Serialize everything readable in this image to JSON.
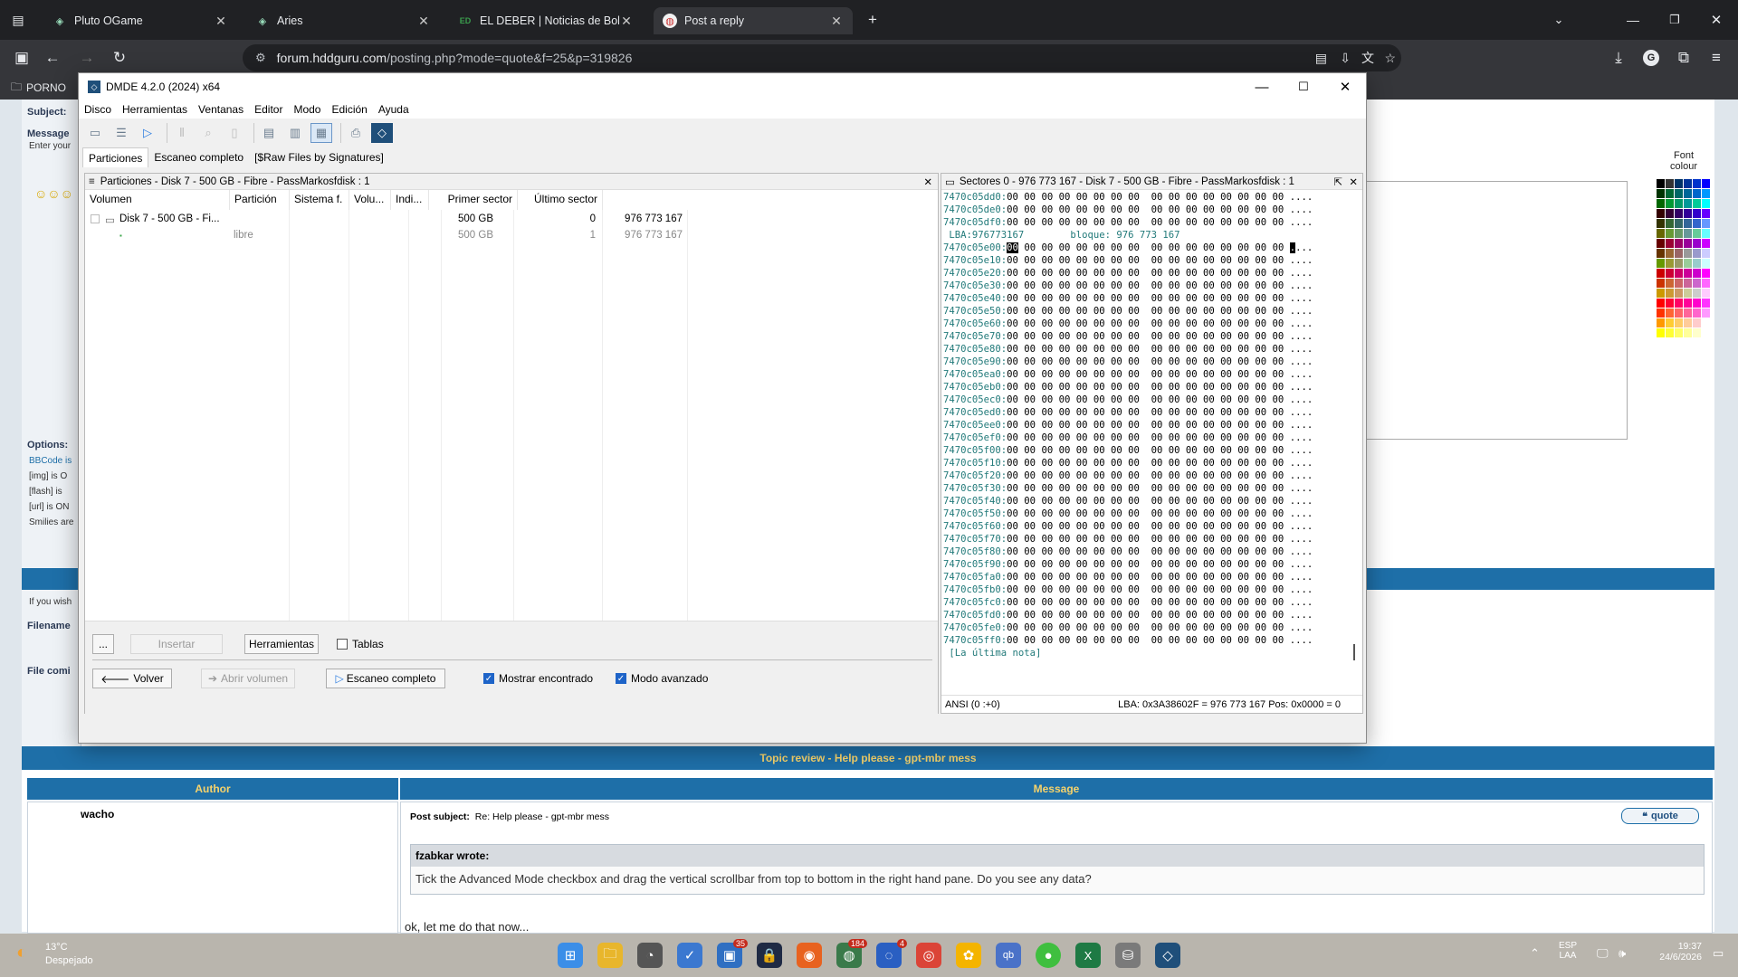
{
  "browser": {
    "tabs": [
      {
        "label": "Pluto OGame",
        "icon": "pluto-icon"
      },
      {
        "label": "Aries",
        "icon": "aries-icon"
      },
      {
        "label": "EL DEBER | Noticias de Bolivia y",
        "icon": "eldeber-icon"
      },
      {
        "label": "Post a reply",
        "icon": "hddguru-icon",
        "active": true
      }
    ],
    "url_domain": "forum.hddguru.com",
    "url_path": "/posting.php?mode=quote&f=25&p=319826",
    "bookmark": "PORNO",
    "profile_initial": "G"
  },
  "forum": {
    "subject_label": "Subject:",
    "message_label": "Message",
    "message_hint": "Enter your",
    "options_label": "Options:",
    "options": [
      "BBCode is",
      "[img] is O",
      "[flash] is",
      "[url] is ON",
      "Smilies are"
    ],
    "if_you_wish": "If you wish",
    "filename_label": "Filename",
    "file_comment_label": "File comi",
    "font_colour": "Font colour",
    "topic_review": "Topic review - Help please - gpt-mbr mess",
    "author_header": "Author",
    "message_header": "Message",
    "author": "wacho",
    "post_subject_label": "Post subject:",
    "post_subject": "Re: Help please - gpt-mbr mess",
    "quote_button": "quote",
    "quote_author": "fzabkar wrote:",
    "quote_text": "Tick the Advanced Mode checkbox and drag the vertical scrollbar from top to bottom in the right hand pane. Do you see any data?",
    "reply_text": "ok, let me do that now..."
  },
  "dmde": {
    "title": "DMDE 4.2.0 (2024) x64",
    "menu": [
      "Disco",
      "Herramientas",
      "Ventanas",
      "Editor",
      "Modo",
      "Edición",
      "Ayuda"
    ],
    "tabs": [
      "Particiones",
      "Escaneo completo",
      "[$Raw Files by Signatures]"
    ],
    "left_pane": {
      "title": "Particiones - Disk 7 - 500 GB - Fibre - PassMarkosfdisk : 1",
      "columns": [
        "Volumen",
        "Partición",
        "Sistema f.",
        "Volu...",
        "Indi...",
        "Primer sector",
        "Último sector"
      ],
      "rows": [
        {
          "volume": "Disk 7 - 500 GB - Fi...",
          "partition": "",
          "size": "500 GB",
          "first": "0",
          "last": "976 773 167"
        },
        {
          "volume": "",
          "partition": "libre",
          "size": "500 GB",
          "first": "1",
          "last": "976 773 167"
        }
      ],
      "buttons": {
        "more": "...",
        "insert": "Insertar",
        "tools": "Herramientas",
        "tables": "Tablas",
        "back": "Volver",
        "open_volume": "Abrir volumen",
        "full_scan": "Escaneo completo"
      },
      "checks": {
        "show_found": "Mostrar encontrado",
        "advanced_mode": "Modo avanzado"
      }
    },
    "right_pane": {
      "title": "Sectores 0 - 976 773 167 - Disk 7 - 500 GB - Fibre - PassMarkosfdisk : 1",
      "top_rows": [
        "7470c05dd0",
        "7470c05de0",
        "7470c05df0"
      ],
      "lba_line": " LBA:976773167        bloque: 976 773 167",
      "rows": [
        "7470c05e00",
        "7470c05e10",
        "7470c05e20",
        "7470c05e30",
        "7470c05e40",
        "7470c05e50",
        "7470c05e60",
        "7470c05e70",
        "7470c05e80",
        "7470c05e90",
        "7470c05ea0",
        "7470c05eb0",
        "7470c05ec0",
        "7470c05ed0",
        "7470c05ee0",
        "7470c05ef0",
        "7470c05f00",
        "7470c05f10",
        "7470c05f20",
        "7470c05f30",
        "7470c05f40",
        "7470c05f50",
        "7470c05f60",
        "7470c05f70",
        "7470c05f80",
        "7470c05f90",
        "7470c05fa0",
        "7470c05fb0",
        "7470c05fc0",
        "7470c05fd0",
        "7470c05fe0",
        "7470c05ff0"
      ],
      "hex_bytes": "00 00 00 00 00 00 00 00  00 00 00 00 00 00 00 00",
      "ascii": "....",
      "last_note": " [La última nota]",
      "status_left": "ANSI (0 :+0)",
      "status_right": "LBA: 0x3A38602F = 976 773 167  Pos: 0x0000 = 0"
    }
  },
  "taskbar": {
    "weather_temp": "13°C",
    "weather_desc": "Despejado",
    "lang": "ESP",
    "lang2": "LAA",
    "time": "19:37",
    "date": "24/6/2026",
    "badge_35": "35",
    "badge_184": "184",
    "badge_4": "4"
  }
}
